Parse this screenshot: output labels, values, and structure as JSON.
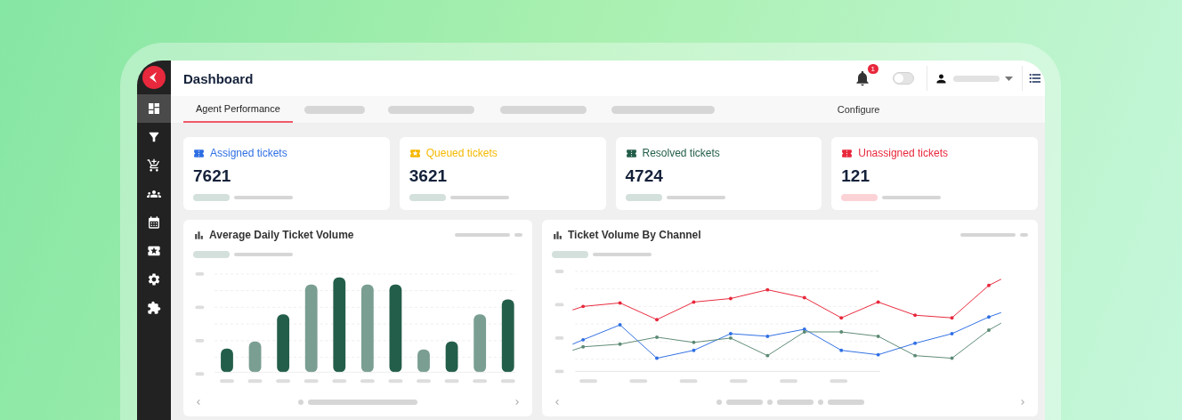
{
  "header": {
    "title": "Dashboard",
    "notification_count": "1",
    "theme_toggle": {
      "on": false
    }
  },
  "sidebar": {
    "items": [
      {
        "selected": true
      },
      {
        "selected": false
      },
      {
        "selected": false
      },
      {
        "selected": false
      },
      {
        "selected": false
      },
      {
        "selected": false
      },
      {
        "selected": false
      },
      {
        "selected": false
      }
    ]
  },
  "tabs": [
    {
      "label": "Agent Performance",
      "selected": true
    }
  ],
  "configure_link": "Configure",
  "stat_cards": [
    {
      "label": "Assigned tickets",
      "value": "7621",
      "color": "#2f6fe4",
      "alert": false
    },
    {
      "label": "Queued tickets",
      "value": "3621",
      "color": "#f5b800",
      "alert": false
    },
    {
      "label": "Resolved tickets",
      "value": "4724",
      "color": "#235e4a",
      "alert": false
    },
    {
      "label": "Unassigned tickets",
      "value": "121",
      "color": "#e8283c",
      "alert": true
    }
  ],
  "charts": [
    {
      "kind": "bar",
      "title": "Average Daily Ticket Volume"
    },
    {
      "kind": "line",
      "title": "Ticket Volume By Channel"
    }
  ]
}
